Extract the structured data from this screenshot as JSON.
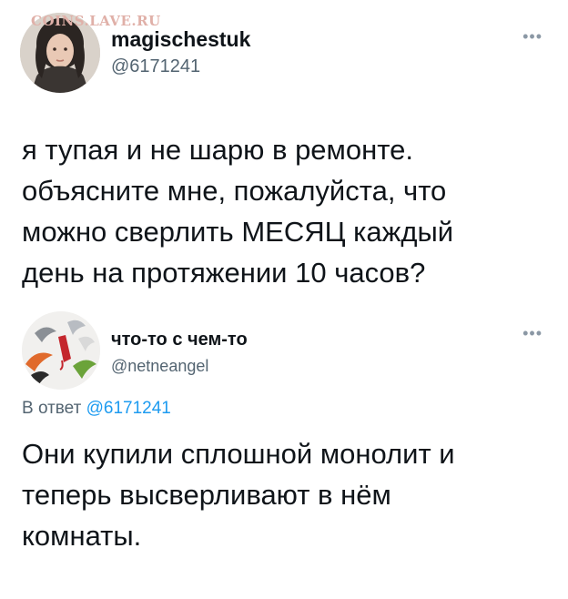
{
  "watermark": "COINS.LAVE.RU",
  "tweets": [
    {
      "name": "magischestuk",
      "handle": "@6171241",
      "more_icon": "more-dots-icon",
      "text": "я тупая и не шарю в ремонте.\nобъясните мне, пожалуйста, что\nможно сверлить МЕСЯЦ каждый\nдень на протяжении 10 часов?"
    },
    {
      "name": "что-то с чем-то",
      "handle": "@netneangel",
      "more_icon": "more-dots-icon",
      "reply_prefix": "В ответ",
      "reply_mention": "@6171241",
      "text": "Они купили сплошной монолит и\nтеперь высверливают в нём\nкомнаты."
    }
  ],
  "colors": {
    "text": "#0f1419",
    "secondary": "#536471",
    "link": "#1d9bf0",
    "watermark": "#e0b0a8"
  }
}
